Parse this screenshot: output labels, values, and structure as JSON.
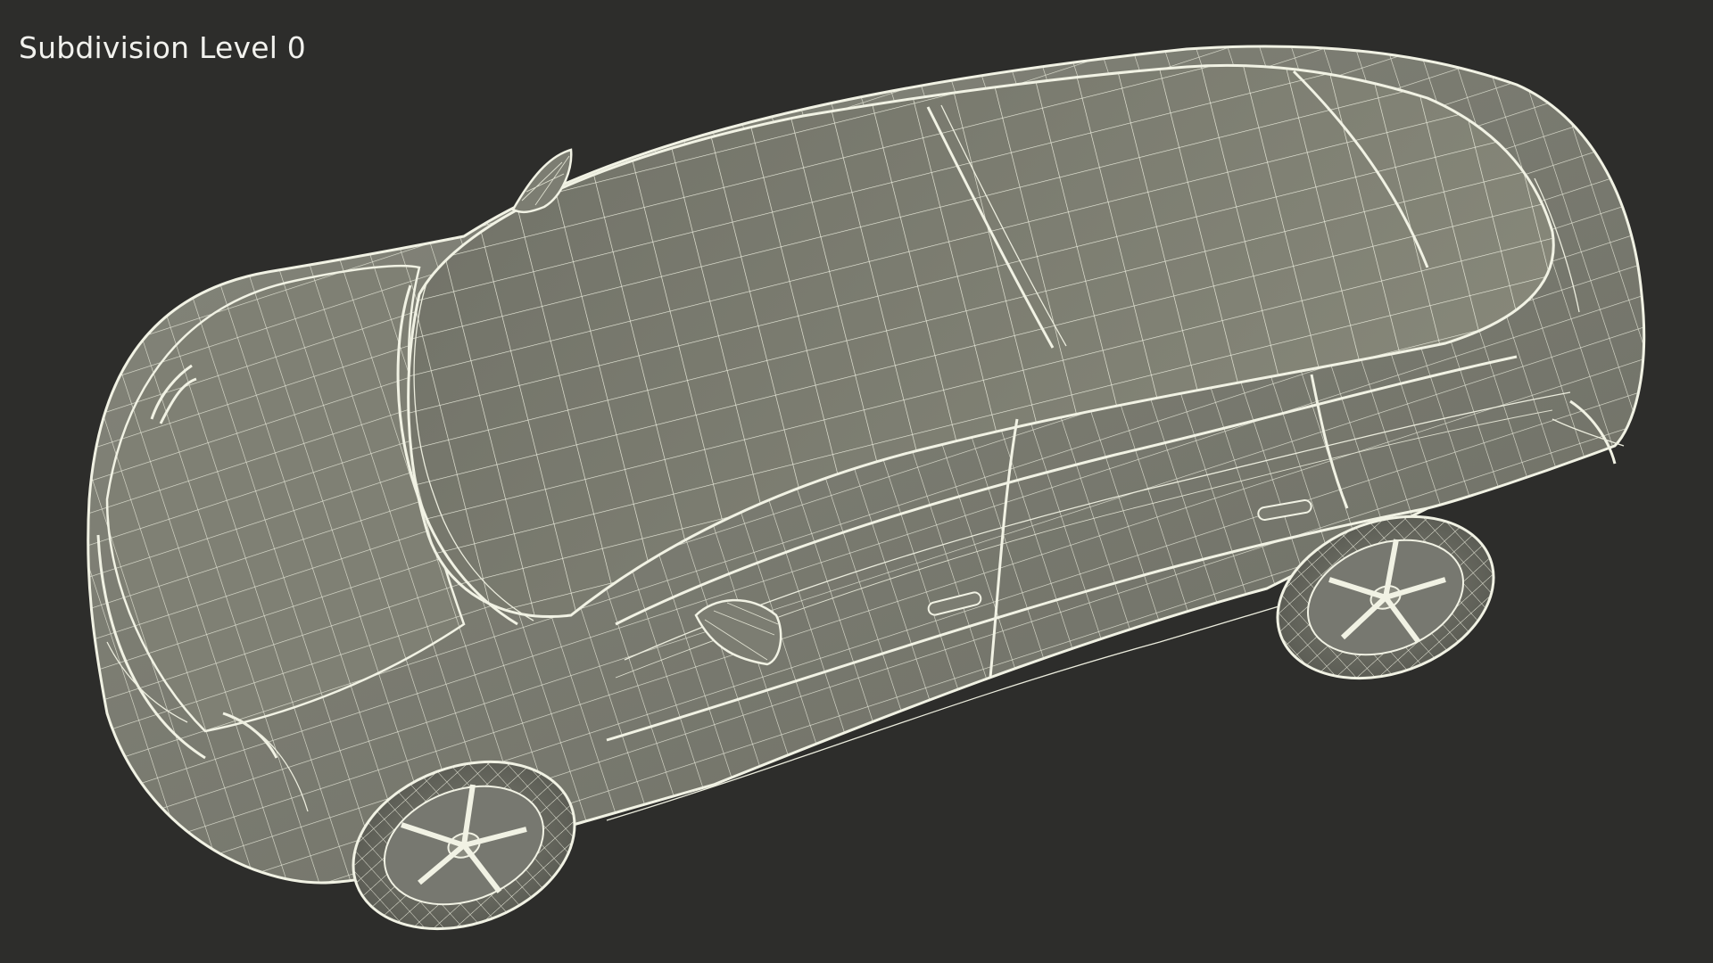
{
  "viewport": {
    "overlay_label": "Subdivision Level 0",
    "colors": {
      "background": "#2d2d2b",
      "surface": "#7c7d72",
      "surface_shadow": "#6b6c62",
      "wireframe": "#ecedde"
    }
  }
}
